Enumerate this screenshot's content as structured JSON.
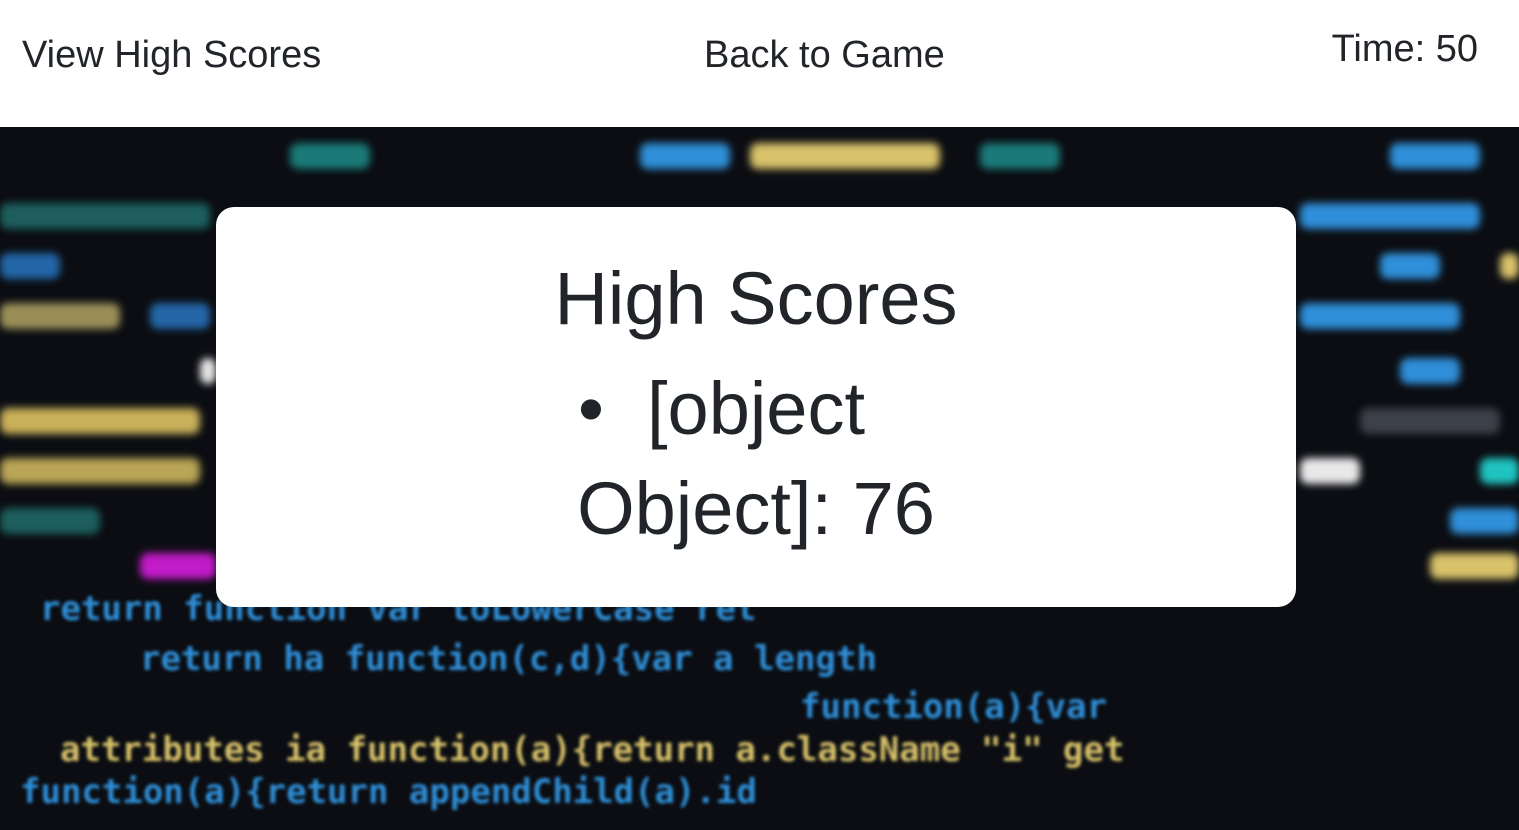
{
  "nav": {
    "view_high_scores": "View High Scores",
    "back_to_game": "Back to Game",
    "timer": "Time: 50"
  },
  "card": {
    "title": "High Scores",
    "scores": [
      "[object Object]: 76"
    ]
  },
  "background": {
    "description_icon": "blurred-code-background",
    "code_lines": [
      {
        "text": "return function var toLowerCase ret"
      },
      {
        "text": "return ha function(c,d){var a length"
      },
      {
        "text": "function(a){var"
      },
      {
        "text": "attributes ia function(a){return a.className \"i\" get"
      },
      {
        "text": "function(a){return appendChild(a).id"
      }
    ],
    "colors": {
      "blue": "#2f8fd8",
      "cyan": "#1fc4c0",
      "yellow": "#d8c26a",
      "white": "#e8e8e8",
      "magenta": "#c21bc8",
      "gray": "#3c4048"
    }
  }
}
